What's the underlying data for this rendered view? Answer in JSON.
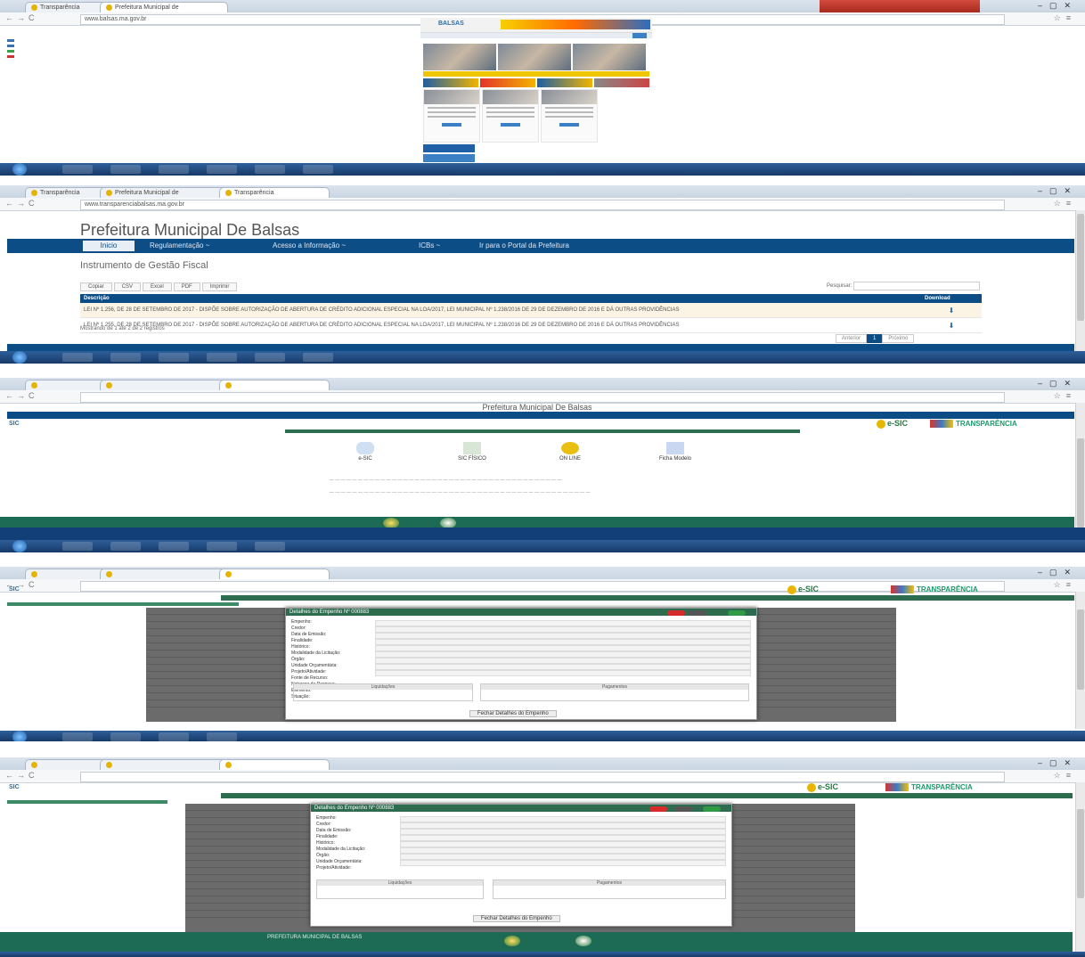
{
  "shot1": {
    "tab1": "Transparência",
    "tab2": "Prefeitura Municipal de",
    "url": "www.balsas.ma.gov.br",
    "logo": "BALSAS"
  },
  "shot2": {
    "tabs": [
      "Transparência",
      "Prefeitura Municipal de",
      "Transparência"
    ],
    "url": "www.transparenciabalsas.ma.gov.br",
    "title": "Prefeitura Municipal De Balsas",
    "nav": [
      "Inicio",
      "Regulamentação ~",
      "Acesso a Informação ~",
      "ICBs ~",
      "Ir para o Portal da Prefeitura"
    ],
    "section": "Instrumento de Gestão Fiscal",
    "export_buttons": [
      "Copiar",
      "CSV",
      "Excel",
      "PDF",
      "Imprimir"
    ],
    "search_label": "Pesquisar:",
    "table_headers": [
      "Descrição",
      "Download"
    ],
    "rows": [
      "LEI Nº 1.256, DE 28 DE SETEMBRO DE 2017 - DISPÕE SOBRE AUTORIZAÇÃO DE ABERTURA DE CRÉDITO ADICIONAL ESPECIAL NA LOA/2017, LEI MUNICIPAL Nº 1.238/2016 DE 29 DE DEZEMBRO DE 2016 E DÁ OUTRAS PROVIDÊNCIAS",
      "LEI Nº 1.255, DE 28 DE SETEMBRO DE 2017 - DISPÕE SOBRE AUTORIZAÇÃO DE ABERTURA DE CRÉDITO ADICIONAL ESPECIAL NA LOA/2017, LEI MUNICIPAL Nº 1.238/2016 DE 29 DE DEZEMBRO DE 2016 E DÁ OUTRAS PROVIDÊNCIAS"
    ],
    "info": "Mostrando de 1 até 2 de 2 registros",
    "pager": [
      "Anterior",
      "1",
      "Próximo"
    ]
  },
  "shot3": {
    "title": "Prefeitura Municipal De Balsas",
    "cards": [
      "e-SIC",
      "SIC FÍSICO",
      "ON LINE",
      "Ficha Modelo"
    ],
    "esic": "e-SIC",
    "transparencia": "TRANSPARÊNCIA"
  },
  "shot4": {
    "modal_title": "Detalhes do Empenho Nº 000883",
    "labels": [
      "Empenho:",
      "Credor:",
      "Data de Emissão:",
      "Finalidade:",
      "Histórico:",
      "Modalidade da Licitação:",
      "Órgão:",
      "Unidade Orçamentária:",
      "Projeto/Atividade:",
      "Fonte de Recurso:",
      "Natureza da Despesa:",
      "Elemento:",
      "Situação:"
    ],
    "sub_left": "Liquidações",
    "sub_right": "Pagamentos",
    "close": "Fechar Detalhes do Empenho",
    "esic": "e-SIC",
    "transparencia": "TRANSPARÊNCIA"
  },
  "shot5": {
    "modal_title": "Detalhes do Empenho Nº 000883",
    "footer": "PREFEITURA MUNICIPAL DE BALSAS",
    "close": "Fechar Detalhes do Empenho",
    "esic": "e-SIC",
    "transparencia": "TRANSPARÊNCIA"
  }
}
